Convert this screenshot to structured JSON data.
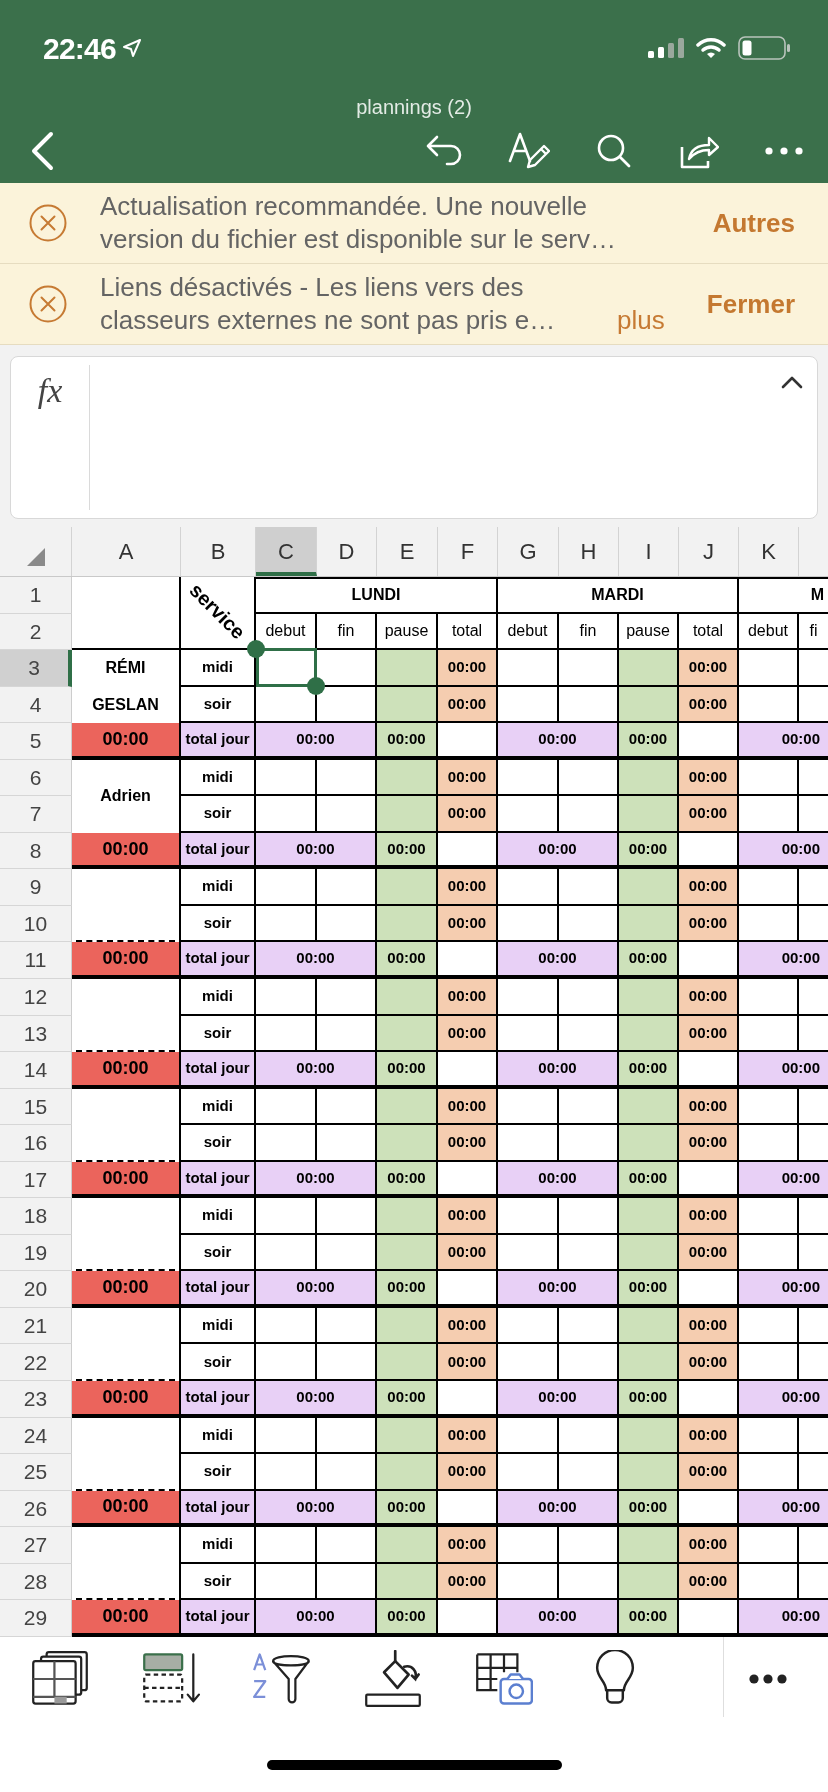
{
  "status_bar": {
    "time": "22:46"
  },
  "document": {
    "title": "plannings (2)"
  },
  "banners": [
    {
      "message": "Actualisation recommandée. Une nouvelle version du fichier est disponible sur le serv…",
      "action": "Autres"
    },
    {
      "message": "Liens désactivés - Les liens vers des classeurs externes ne sont pas pris e…",
      "link": "plus",
      "action": "Fermer"
    }
  ],
  "formula_bar": {
    "label": "fx"
  },
  "column_headers": [
    {
      "label": "A",
      "selected": false
    },
    {
      "label": "B",
      "selected": false
    },
    {
      "label": "C",
      "selected": true
    },
    {
      "label": "D",
      "selected": false
    },
    {
      "label": "E",
      "selected": false
    },
    {
      "label": "F",
      "selected": false
    },
    {
      "label": "G",
      "selected": false
    },
    {
      "label": "H",
      "selected": false
    },
    {
      "label": "I",
      "selected": false
    },
    {
      "label": "J",
      "selected": false
    },
    {
      "label": "K",
      "selected": false
    }
  ],
  "row_headers": [
    {
      "label": "1",
      "selected": false
    },
    {
      "label": "2",
      "selected": false
    },
    {
      "label": "3",
      "selected": true
    },
    {
      "label": "4",
      "selected": false
    },
    {
      "label": "5",
      "selected": false
    },
    {
      "label": "6",
      "selected": false
    },
    {
      "label": "7",
      "selected": false
    },
    {
      "label": "8",
      "selected": false
    },
    {
      "label": "9",
      "selected": false
    },
    {
      "label": "10",
      "selected": false
    },
    {
      "label": "11",
      "selected": false
    },
    {
      "label": "12",
      "selected": false
    },
    {
      "label": "13",
      "selected": false
    },
    {
      "label": "14",
      "selected": false
    },
    {
      "label": "15",
      "selected": false
    },
    {
      "label": "16",
      "selected": false
    },
    {
      "label": "17",
      "selected": false
    },
    {
      "label": "18",
      "selected": false
    },
    {
      "label": "19",
      "selected": false
    },
    {
      "label": "20",
      "selected": false
    },
    {
      "label": "21",
      "selected": false
    },
    {
      "label": "22",
      "selected": false
    },
    {
      "label": "23",
      "selected": false
    },
    {
      "label": "24",
      "selected": false
    },
    {
      "label": "25",
      "selected": false
    },
    {
      "label": "26",
      "selected": false
    },
    {
      "label": "27",
      "selected": false
    },
    {
      "label": "28",
      "selected": false
    },
    {
      "label": "29",
      "selected": false
    }
  ],
  "sheet": {
    "service_header": "service",
    "days": [
      {
        "label": "LUNDI",
        "columns": [
          "debut",
          "fin",
          "pause",
          "total"
        ]
      },
      {
        "label": "MARDI",
        "columns": [
          "debut",
          "fin",
          "pause",
          "total"
        ]
      },
      {
        "label": "M",
        "columns": [
          "debut",
          "fi"
        ]
      }
    ],
    "groups": [
      {
        "names": [
          "RÉMI",
          "GESLAN"
        ],
        "shifts": [
          {
            "service": "midi",
            "totals": [
              "00:00",
              "00:00"
            ]
          },
          {
            "service": "soir",
            "totals": [
              "00:00",
              "00:00"
            ]
          }
        ],
        "summary": {
          "week_total": "00:00",
          "label": "total jour",
          "days": [
            {
              "hours": "00:00",
              "pause": "00:00"
            },
            {
              "hours": "00:00",
              "pause": "00:00"
            },
            {
              "hours": "00:00"
            }
          ]
        }
      },
      {
        "names": [
          "Adrien"
        ],
        "shifts": [
          {
            "service": "midi",
            "totals": [
              "00:00",
              "00:00"
            ]
          },
          {
            "service": "soir",
            "totals": [
              "00:00",
              "00:00"
            ]
          }
        ],
        "summary": {
          "week_total": "00:00",
          "label": "total jour",
          "days": [
            {
              "hours": "00:00",
              "pause": "00:00"
            },
            {
              "hours": "00:00",
              "pause": "00:00"
            },
            {
              "hours": "00:00"
            }
          ]
        }
      },
      {
        "shifts": [
          {
            "service": "midi",
            "totals": [
              "00:00",
              "00:00"
            ]
          },
          {
            "service": "soir",
            "totals": [
              "00:00",
              "00:00"
            ]
          }
        ],
        "summary": {
          "week_total": "00:00",
          "label": "total jour",
          "days": [
            {
              "hours": "00:00",
              "pause": "00:00"
            },
            {
              "hours": "00:00",
              "pause": "00:00"
            },
            {
              "hours": "00:00"
            }
          ]
        }
      },
      {
        "shifts": [
          {
            "service": "midi",
            "totals": [
              "00:00",
              "00:00"
            ]
          },
          {
            "service": "soir",
            "totals": [
              "00:00",
              "00:00"
            ]
          }
        ],
        "summary": {
          "week_total": "00:00",
          "label": "total jour",
          "days": [
            {
              "hours": "00:00",
              "pause": "00:00"
            },
            {
              "hours": "00:00",
              "pause": "00:00"
            },
            {
              "hours": "00:00"
            }
          ]
        }
      },
      {
        "shifts": [
          {
            "service": "midi",
            "totals": [
              "00:00",
              "00:00"
            ]
          },
          {
            "service": "soir",
            "totals": [
              "00:00",
              "00:00"
            ]
          }
        ],
        "summary": {
          "week_total": "00:00",
          "label": "total jour",
          "days": [
            {
              "hours": "00:00",
              "pause": "00:00"
            },
            {
              "hours": "00:00",
              "pause": "00:00"
            },
            {
              "hours": "00:00"
            }
          ]
        }
      },
      {
        "shifts": [
          {
            "service": "midi",
            "totals": [
              "00:00",
              "00:00"
            ]
          },
          {
            "service": "soir",
            "totals": [
              "00:00",
              "00:00"
            ]
          }
        ],
        "summary": {
          "week_total": "00:00",
          "label": "total jour",
          "days": [
            {
              "hours": "00:00",
              "pause": "00:00"
            },
            {
              "hours": "00:00",
              "pause": "00:00"
            },
            {
              "hours": "00:00"
            }
          ]
        }
      },
      {
        "shifts": [
          {
            "service": "midi",
            "totals": [
              "00:00",
              "00:00"
            ]
          },
          {
            "service": "soir",
            "totals": [
              "00:00",
              "00:00"
            ]
          }
        ],
        "summary": {
          "week_total": "00:00",
          "label": "total jour",
          "days": [
            {
              "hours": "00:00",
              "pause": "00:00"
            },
            {
              "hours": "00:00",
              "pause": "00:00"
            },
            {
              "hours": "00:00"
            }
          ]
        }
      },
      {
        "shifts": [
          {
            "service": "midi",
            "totals": [
              "00:00",
              "00:00"
            ]
          },
          {
            "service": "soir",
            "totals": [
              "00:00",
              "00:00"
            ]
          }
        ],
        "summary": {
          "week_total": "00:00",
          "label": "total jour",
          "days": [
            {
              "hours": "00:00",
              "pause": "00:00"
            },
            {
              "hours": "00:00",
              "pause": "00:00"
            },
            {
              "hours": "00:00"
            }
          ]
        }
      },
      {
        "shifts": [
          {
            "service": "midi",
            "totals": [
              "00:00",
              "00:00"
            ]
          },
          {
            "service": "soir",
            "totals": [
              "00:00",
              "00:00"
            ]
          }
        ],
        "summary": {
          "week_total": "00:00",
          "label": "total jour",
          "days": [
            {
              "hours": "00:00",
              "pause": "00:00"
            },
            {
              "hours": "00:00",
              "pause": "00:00"
            },
            {
              "hours": "00:00"
            }
          ]
        }
      }
    ]
  }
}
